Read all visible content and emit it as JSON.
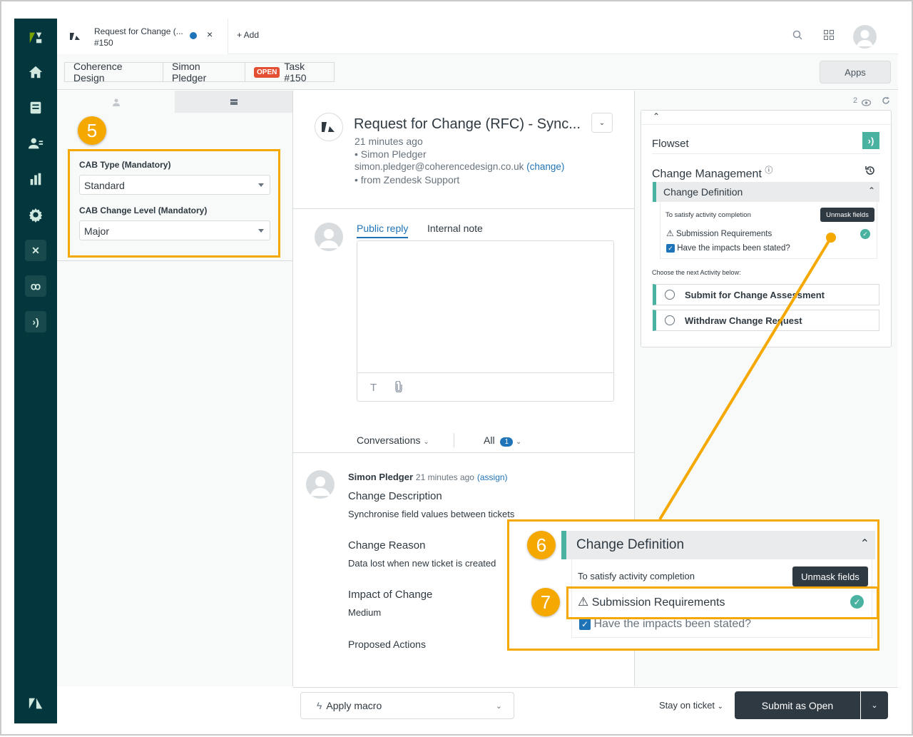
{
  "tab": {
    "title": "Request for Change (...",
    "subtitle": "#150",
    "close": "×",
    "add_label": "+ Add"
  },
  "breadcrumb": {
    "org": "Coherence Design",
    "user": "Simon Pledger",
    "status_badge": "OPEN",
    "task": "Task #150"
  },
  "apps_label": "Apps",
  "left_panel": {
    "callout_number": "5",
    "fields": [
      {
        "label": "CAB Type (Mandatory)",
        "value": "Standard"
      },
      {
        "label": "CAB Change Level (Mandatory)",
        "value": "Major"
      }
    ]
  },
  "ticket": {
    "title": "Request for Change (RFC) - Sync...",
    "time": "21 minutes ago",
    "requester": "• Simon Pledger",
    "email": "simon.pledger@coherencedesign.co.uk",
    "change_link": "(change)",
    "source": "• from Zendesk Support"
  },
  "composer": {
    "public_reply": "Public reply",
    "internal_note": "Internal note",
    "text_icon": "T"
  },
  "filters": {
    "conversations": "Conversations",
    "all": "All",
    "all_count": "1"
  },
  "message": {
    "author": "Simon Pledger",
    "time": "21 minutes ago",
    "assign": "(assign)",
    "sections": [
      {
        "heading": "Change Description",
        "text": "Synchronise field values between tickets"
      },
      {
        "heading": "Change Reason",
        "text": "Data lost when new ticket is created"
      },
      {
        "heading": "Impact of Change",
        "text": "Medium"
      },
      {
        "heading": "Proposed Actions",
        "text": ""
      }
    ]
  },
  "right_panel": {
    "viewer_count": "2",
    "flowset_label": "Flowset",
    "change_mgmt": "Change Management",
    "change_def": "Change Definition",
    "satisfy": "To satisfy activity completion",
    "unmask": "Unmask fields",
    "submission_req": "Submission Requirements",
    "impacts_q": "Have the impacts been stated?",
    "next_activity": "Choose the next Activity below:",
    "activities": [
      "Submit for Change Assessment",
      "Withdraw Change Request"
    ]
  },
  "zoom": {
    "number_a": "6",
    "number_b": "7",
    "change_def": "Change Definition",
    "satisfy": "To satisfy activity completion",
    "unmask": "Unmask fields",
    "submission_req": "Submission Requirements",
    "impacts_q": "Have the impacts been stated?"
  },
  "bottom": {
    "macro": "Apply macro",
    "stay": "Stay on ticket",
    "submit": "Submit as Open"
  },
  "colors": {
    "accent_orange": "#f5a800",
    "sidebar": "#03363d",
    "teal": "#4ab2a0",
    "link_blue": "#1f73b7"
  }
}
